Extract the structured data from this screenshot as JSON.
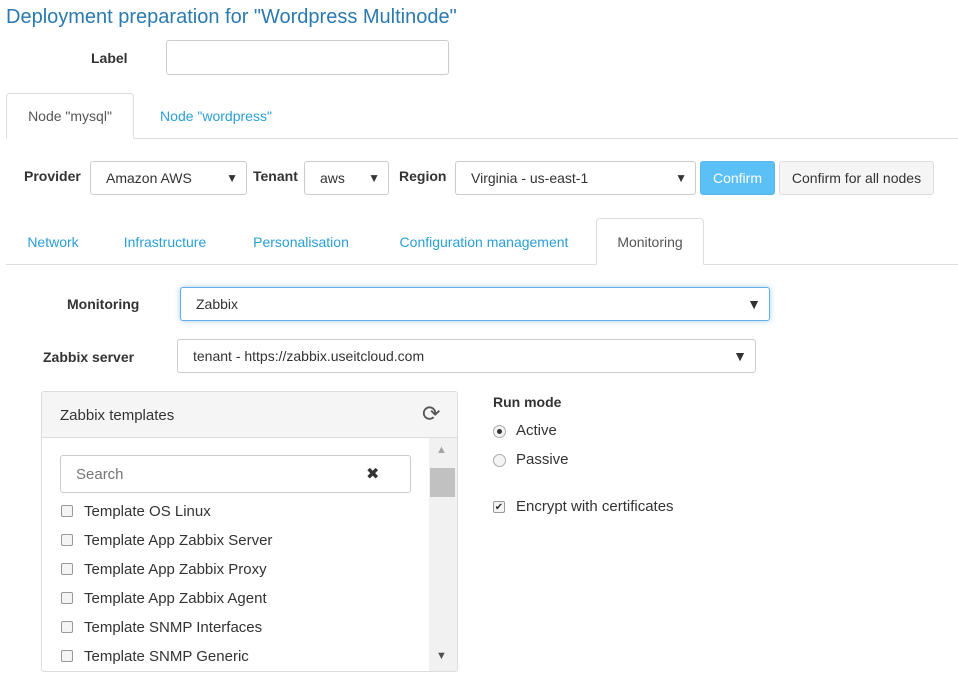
{
  "page": {
    "title": "Deployment preparation for \"Wordpress Multinode\""
  },
  "label_field": {
    "label": "Label",
    "value": ""
  },
  "node_tabs": [
    {
      "label": "Node \"mysql\"",
      "active": true
    },
    {
      "label": "Node \"wordpress\"",
      "active": false
    }
  ],
  "provider_bar": {
    "provider_label": "Provider",
    "provider_value": "Amazon AWS",
    "tenant_label": "Tenant",
    "tenant_value": "aws",
    "region_label": "Region",
    "region_value": "Virginia - us-east-1",
    "confirm_label": "Confirm",
    "confirm_all_label": "Confirm for all nodes"
  },
  "section_tabs": [
    {
      "label": "Network",
      "active": false
    },
    {
      "label": "Infrastructure",
      "active": false
    },
    {
      "label": "Personalisation",
      "active": false
    },
    {
      "label": "Configuration management",
      "active": false
    },
    {
      "label": "Monitoring",
      "active": true
    }
  ],
  "monitoring": {
    "monitoring_label": "Monitoring",
    "monitoring_value": "Zabbix",
    "server_label": "Zabbix server",
    "server_value": "tenant - https://zabbix.useitcloud.com"
  },
  "templates_panel": {
    "title": "Zabbix templates",
    "search_placeholder": "Search",
    "clear_glyph": "✖",
    "refresh_glyph": "⟳",
    "items": [
      {
        "label": "Template OS Linux",
        "checked": false
      },
      {
        "label": "Template App Zabbix Server",
        "checked": false
      },
      {
        "label": "Template App Zabbix Proxy",
        "checked": false
      },
      {
        "label": "Template App Zabbix Agent",
        "checked": false
      },
      {
        "label": "Template SNMP Interfaces",
        "checked": false
      },
      {
        "label": "Template SNMP Generic",
        "checked": false
      }
    ]
  },
  "run_mode": {
    "title": "Run mode",
    "options": [
      {
        "label": "Active",
        "selected": true
      },
      {
        "label": "Passive",
        "selected": false
      }
    ],
    "encrypt_label": "Encrypt with certificates",
    "encrypt_checked": true
  },
  "glyphs": {
    "dropdown": "▼",
    "scroll_up": "▲",
    "scroll_down": "▼",
    "check": "✔"
  },
  "colors": {
    "title": "#2a7ab0",
    "link": "#2a9fd6",
    "confirm_bg": "#5bc0f5",
    "focus_border": "#66afe9"
  }
}
